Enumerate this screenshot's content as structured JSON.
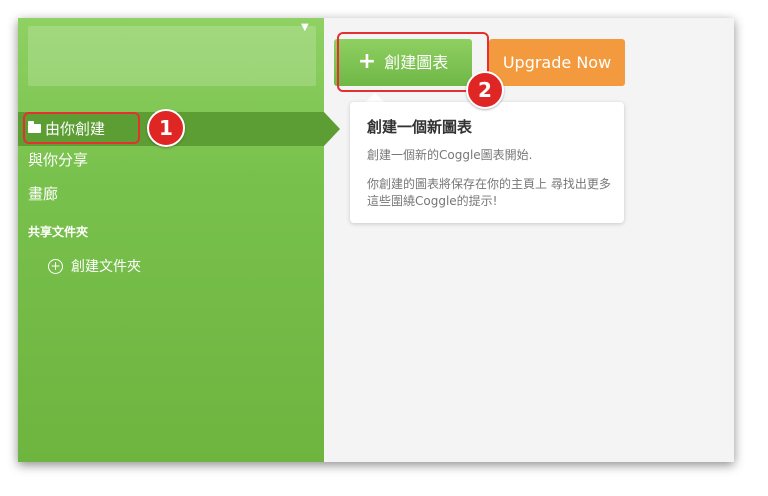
{
  "sidebar": {
    "nav": [
      {
        "label": "由你創建",
        "icon": "folder-icon",
        "active": true
      },
      {
        "label": "與你分享"
      },
      {
        "label": "畫廊"
      }
    ],
    "section_label": "共享文件夾",
    "create_folder_label": "創建文件夾"
  },
  "toolbar": {
    "create_label": "創建圖表",
    "upgrade_label": "Upgrade Now"
  },
  "popover": {
    "title": "創建一個新圖表",
    "line1": "創建一個新的Coggle圖表開始.",
    "line2": "你創建的圖表將保存在你的主頁上 尋找出更多這些圍繞Coggle的提示!"
  },
  "annotations": {
    "badge1": "1",
    "badge2": "2"
  },
  "colors": {
    "sidebar_green": "#79c14d",
    "active_green": "#5c9e33",
    "upgrade_orange": "#f39a3f",
    "highlight_red": "#e63030"
  }
}
